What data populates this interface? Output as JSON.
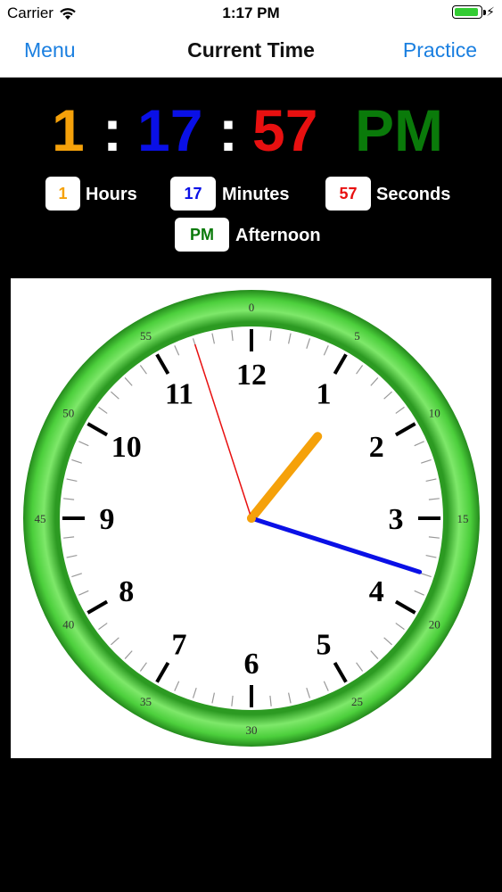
{
  "status": {
    "carrier": "Carrier",
    "time": "1:17 PM"
  },
  "nav": {
    "menu_label": "Menu",
    "title": "Current Time",
    "practice_label": "Practice"
  },
  "time": {
    "hour": "1",
    "minute": "17",
    "second": "57",
    "ampm": "PM",
    "colon": ":",
    "hour_value": 1,
    "minute_value": 17,
    "second_value": 57
  },
  "labels": {
    "hours": "Hours",
    "minutes": "Minutes",
    "seconds": "Seconds",
    "afternoon": "Afternoon"
  },
  "colors": {
    "hour": "#f5a10a",
    "minute": "#0a10e6",
    "second": "#e81010",
    "ampm": "#0a7a0a",
    "accent": "#1a7fe0",
    "ring": "#4ccf3c"
  },
  "clock": {
    "hour_numbers": [
      "12",
      "1",
      "2",
      "3",
      "4",
      "5",
      "6",
      "7",
      "8",
      "9",
      "10",
      "11"
    ],
    "minute_numbers": [
      "0",
      "5",
      "10",
      "15",
      "20",
      "25",
      "30",
      "35",
      "40",
      "45",
      "50",
      "55"
    ]
  },
  "icons": {
    "wifi": "wifi-icon",
    "battery": "battery-icon",
    "charging": "charging-bolt-icon"
  }
}
